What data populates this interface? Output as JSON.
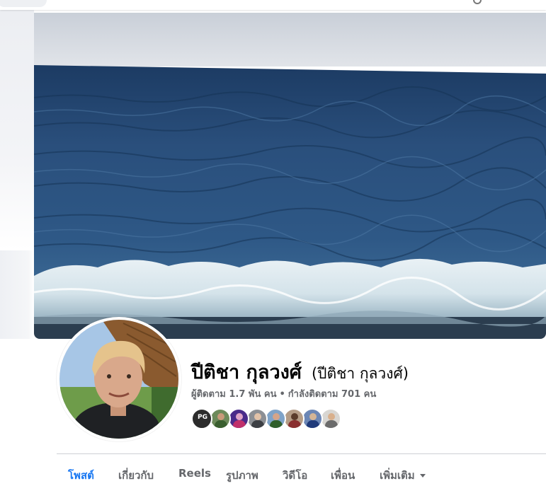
{
  "profile": {
    "name": "ปีติชา กุลวงศ์",
    "alternate_name": "(ปีติชา กุลวงศ์)",
    "followers": "ผู้ติดตาม 1.7 พัน คน",
    "separator": "•",
    "following": "กำลังติดตาม 701 คน"
  },
  "friends": [
    {
      "name": "pg-gaming-avatar",
      "label": "PG",
      "bg": "#2b2b2b",
      "head": "#d7a54b",
      "body": "#444"
    },
    {
      "name": "friend-avatar-2",
      "bg": "#6d8a5a",
      "head": "#c99a7a",
      "body": "#3a5f2f"
    },
    {
      "name": "friend-avatar-3",
      "bg": "#4a2b8a",
      "head": "#e0a5c8",
      "body": "#c0306b"
    },
    {
      "name": "friend-avatar-4",
      "bg": "#8c8f94",
      "head": "#e2c2a8",
      "body": "#3c3f44"
    },
    {
      "name": "friend-avatar-5",
      "bg": "#7fa3c8",
      "head": "#d5a489",
      "body": "#2f5f2a"
    },
    {
      "name": "friend-avatar-6",
      "bg": "#b49c86",
      "head": "#5a3b2a",
      "body": "#8a2f2f"
    },
    {
      "name": "friend-avatar-7",
      "bg": "#6b86b5",
      "head": "#d4b596",
      "body": "#1f3a7a"
    },
    {
      "name": "friend-avatar-8",
      "bg": "#d8d6d2",
      "head": "#d9b08c",
      "body": "#6b6b6b"
    }
  ],
  "tabs": [
    {
      "label": "โพสต์",
      "active": true
    },
    {
      "label": "เกี่ยวกับ",
      "active": false
    },
    {
      "label": "Reels",
      "active": false
    },
    {
      "label": "รูปภาพ",
      "active": false
    },
    {
      "label": "วิดีโอ",
      "active": false
    },
    {
      "label": "เพื่อน",
      "active": false
    },
    {
      "label": "เพิ่มเติม",
      "active": false,
      "dropdown": true
    }
  ],
  "colors": {
    "accent": "#1877f2",
    "secondary_text": "#65676b",
    "primary_text": "#050505"
  }
}
